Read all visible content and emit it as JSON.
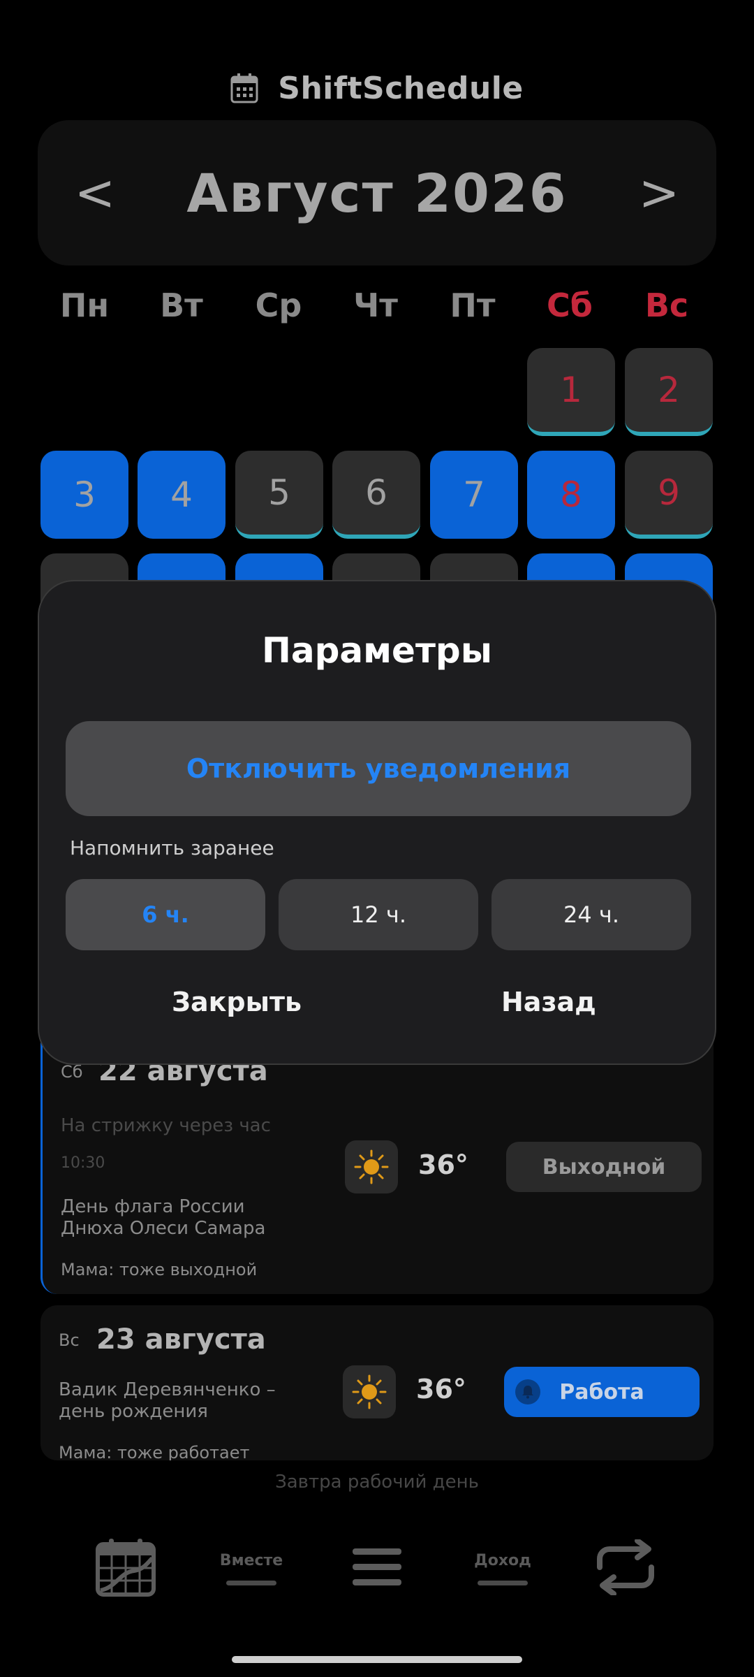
{
  "app": {
    "title": "ShiftSchedule",
    "icon": "calendar-icon"
  },
  "header": {
    "prev_label": "<",
    "month_label": "Август 2026",
    "next_label": ">"
  },
  "weekdays": [
    "Пн",
    "Вт",
    "Ср",
    "Чт",
    "Пт",
    "Сб",
    "Вс"
  ],
  "calendar": {
    "days": [
      "1",
      "2",
      "3",
      "4",
      "5",
      "6",
      "7",
      "8",
      "9"
    ]
  },
  "cards": {
    "sat": {
      "dow": "Сб",
      "date": "22 августа",
      "reminder": "На стрижку через час",
      "time": "10:30",
      "events": [
        "День флага России",
        "Днюха Олеси Самара"
      ],
      "note": "Мама: тоже выходной",
      "weather_icon": "sun-icon",
      "temp": "36°",
      "status": "Выходной"
    },
    "sun": {
      "dow": "Вс",
      "date": "23 августа",
      "events": [
        "Вадик Деревянченко –",
        "день рождения"
      ],
      "note": "Мама: тоже работает",
      "weather_icon": "sun-icon",
      "temp": "36°",
      "status": "Работа"
    }
  },
  "hint": "Завтра рабочий день",
  "bottom_nav": {
    "calendar_icon": "calendar-chart-icon",
    "together_label": "Вместе",
    "menu_icon": "hamburger-menu-icon",
    "income_label": "Доход",
    "sync_icon": "repeat-icon"
  },
  "dialog": {
    "title": "Параметры",
    "primary_label": "Отключить уведомления",
    "remind_label": "Напомнить заранее",
    "options": [
      "6 ч.",
      "12 ч.",
      "24 ч."
    ],
    "close_label": "Закрыть",
    "back_label": "Назад"
  },
  "colors": {
    "accent_blue": "#0a63d6",
    "link_blue": "#2484f5",
    "weekend_red": "#c4283c",
    "underline_teal": "#2fa6b8"
  }
}
